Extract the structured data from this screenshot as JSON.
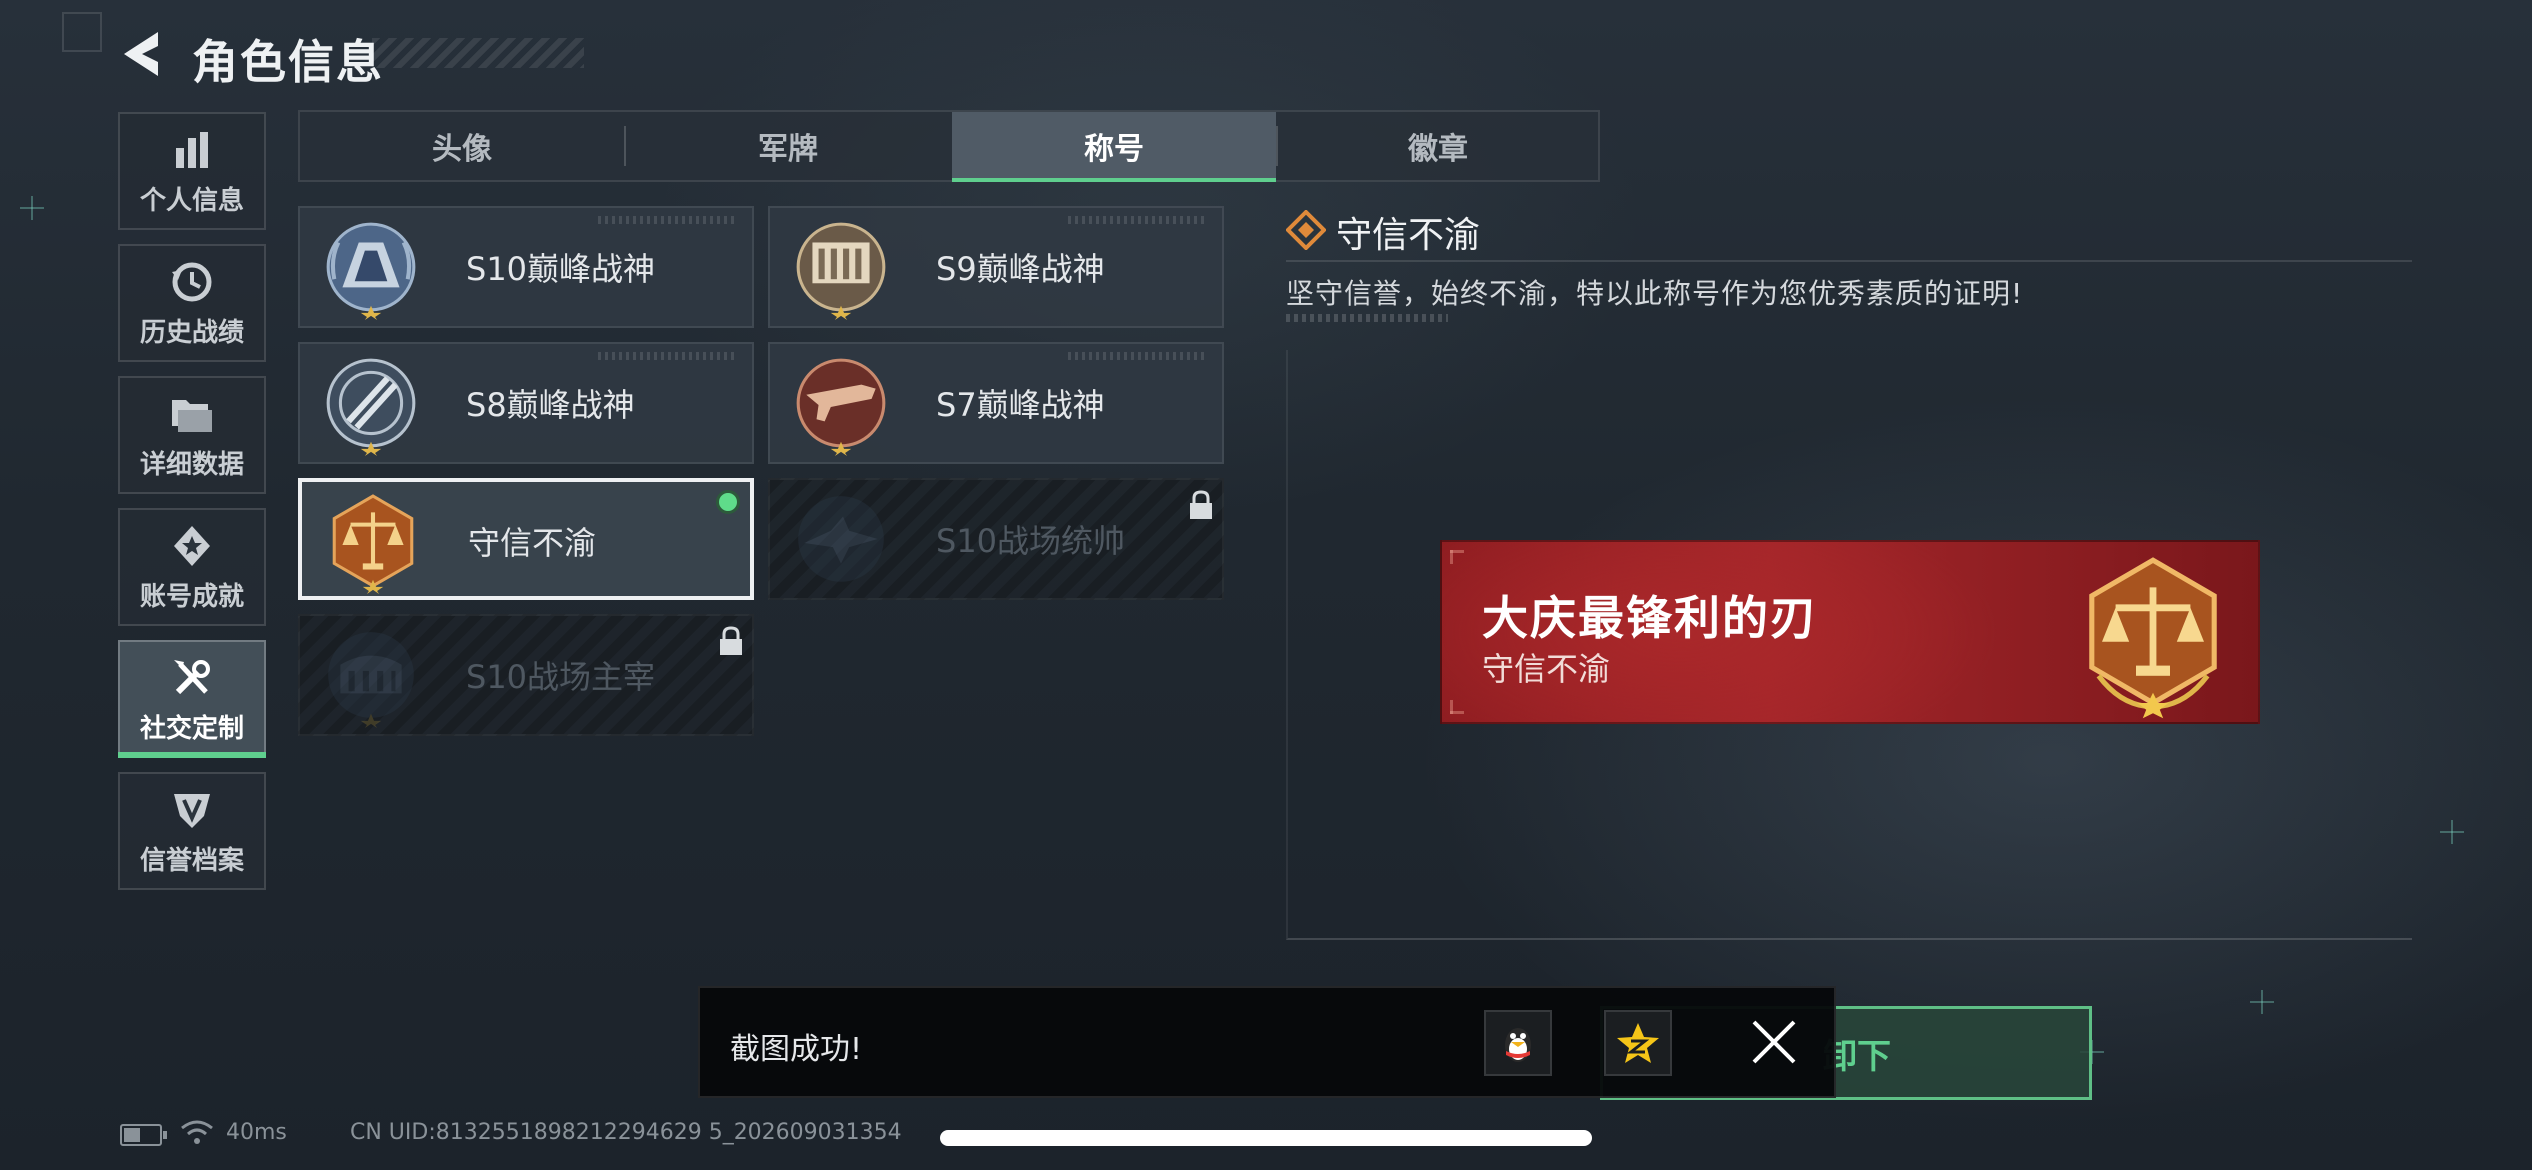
{
  "header": {
    "title": "角色信息"
  },
  "sidebar": {
    "items": [
      {
        "label": "个人信息",
        "icon": "bar-chart-icon",
        "active": false
      },
      {
        "label": "历史战绩",
        "icon": "clock-history-icon",
        "active": false
      },
      {
        "label": "详细数据",
        "icon": "folder-icon",
        "active": false
      },
      {
        "label": "账号成就",
        "icon": "achievement-icon",
        "active": false
      },
      {
        "label": "社交定制",
        "icon": "tools-icon",
        "active": true
      },
      {
        "label": "信誉档案",
        "icon": "credit-shield-icon",
        "active": false
      }
    ]
  },
  "tabs": [
    {
      "label": "头像",
      "active": false
    },
    {
      "label": "军牌",
      "active": false
    },
    {
      "label": "称号",
      "active": true
    },
    {
      "label": "徽章",
      "active": false
    }
  ],
  "titles": [
    {
      "name": "S10巅峰战神",
      "state": "unlocked"
    },
    {
      "name": "S9巅峰战神",
      "state": "unlocked"
    },
    {
      "name": "S8巅峰战神",
      "state": "unlocked"
    },
    {
      "name": "S7巅峰战神",
      "state": "unlocked"
    },
    {
      "name": "守信不渝",
      "state": "selected-equipped"
    },
    {
      "name": "S10战场统帅",
      "state": "locked"
    },
    {
      "name": "S10战场主宰",
      "state": "locked"
    }
  ],
  "detail": {
    "title": "守信不渝",
    "description": "坚守信誉，始终不渝，特以此称号作为您优秀素质的证明!",
    "banner": {
      "player_name": "大庆最锋利的刃",
      "title_name": "守信不渝"
    }
  },
  "unequip_button": {
    "label": "卸下"
  },
  "toast": {
    "text": "截图成功!"
  },
  "status_bar": {
    "ping": "40ms",
    "uid": "CN UID:8132551898212294629 5_202609031354"
  },
  "colors": {
    "accent_green": "#5fcf8e",
    "banner_red": "#a5262a",
    "gold": "#d9a441"
  }
}
